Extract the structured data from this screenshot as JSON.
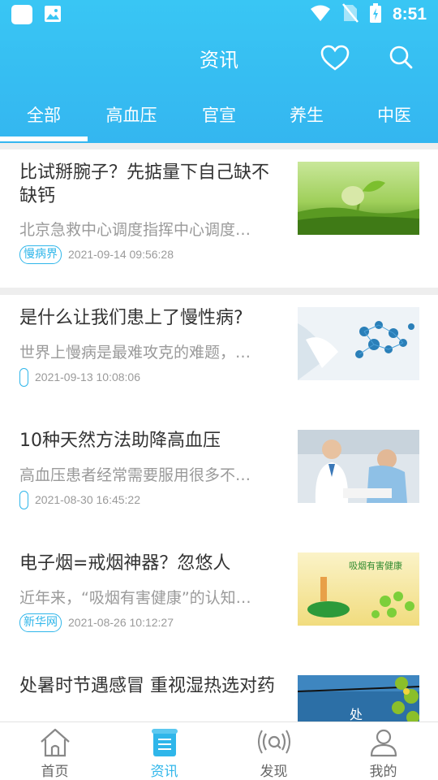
{
  "status_bar": {
    "time": "8:51"
  },
  "header": {
    "title": "资讯"
  },
  "tabs": [
    {
      "label": "全部",
      "active": true
    },
    {
      "label": "高血压",
      "active": false
    },
    {
      "label": "官宣",
      "active": false
    },
    {
      "label": "养生",
      "active": false
    },
    {
      "label": "中医",
      "active": false
    }
  ],
  "articles": [
    {
      "title": "比试掰腕子？先掂量下自己缺不缺钙",
      "summary": "北京急救中心调度指挥中心调度…",
      "tag": "慢病界",
      "date": "2021-09-14 09:56:28",
      "thumbnail": "sprout-image"
    },
    {
      "title": "是什么让我们患上了慢性病?",
      "summary": "世界上慢病是最难攻克的难题，…",
      "tag": "",
      "date": "2021-09-13 10:08:06",
      "thumbnail": "medical-network-image"
    },
    {
      "title": "10种天然方法助降高血压",
      "summary": "高血压患者经常需要服用很多不…",
      "tag": "",
      "date": "2021-08-30 16:45:22",
      "thumbnail": "doctor-patient-image"
    },
    {
      "title": "电子烟=戒烟神器？忽悠人",
      "summary": "近年来，“吸烟有害健康”的认知…",
      "tag": "新华网",
      "date": "2021-08-26 10:12:27",
      "thumbnail": "smoking-poster-image",
      "thumb_text": "吸烟有害健康"
    },
    {
      "title": "处暑时节遇感冒 重视湿热选对药",
      "summary": "",
      "tag": "",
      "date": "",
      "thumbnail": "summer-sky-image",
      "thumb_text": "处"
    }
  ],
  "bottom_nav": [
    {
      "label": "首页",
      "icon": "home-icon",
      "active": false
    },
    {
      "label": "资讯",
      "icon": "news-icon",
      "active": true
    },
    {
      "label": "发现",
      "icon": "discover-icon",
      "active": false
    },
    {
      "label": "我的",
      "icon": "profile-icon",
      "active": false
    }
  ],
  "colors": {
    "header": "#39c6f4",
    "accent": "#2fb6ea",
    "background": "#eeeeee"
  }
}
